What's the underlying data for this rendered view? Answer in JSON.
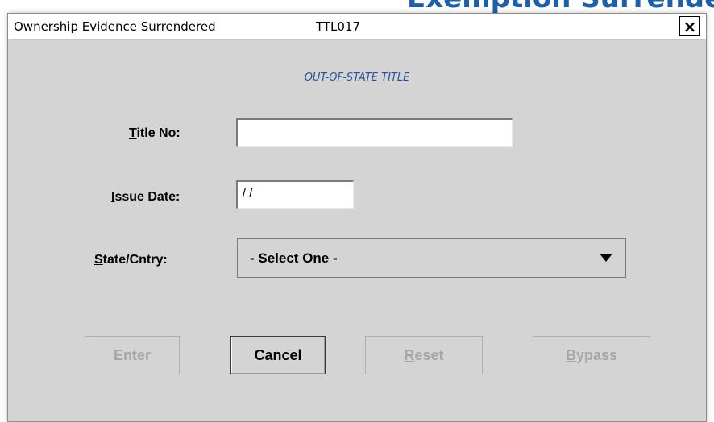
{
  "header_fragment": "Exemption Surrendered",
  "window": {
    "title": "Ownership Evidence Surrendered",
    "code": "TTL017",
    "close_label": "×"
  },
  "form": {
    "heading": "OUT-OF-STATE TITLE",
    "title_no": {
      "label_mnemonic": "T",
      "label_rest": "itle No:",
      "value": ""
    },
    "issue_date": {
      "label_mnemonic": "I",
      "label_rest": "ssue Date:",
      "value": "/ /"
    },
    "state_cntry": {
      "label_mnemonic": "S",
      "label_rest": "tate/Cntry:",
      "selected": "- Select One -"
    }
  },
  "buttons": {
    "enter": {
      "label": "Enter",
      "enabled": false
    },
    "cancel": {
      "label": "Cancel",
      "enabled": true
    },
    "reset": {
      "mnemonic": "R",
      "rest": "eset",
      "enabled": false
    },
    "bypass": {
      "mnemonic": "B",
      "rest": "ypass",
      "enabled": false
    }
  }
}
